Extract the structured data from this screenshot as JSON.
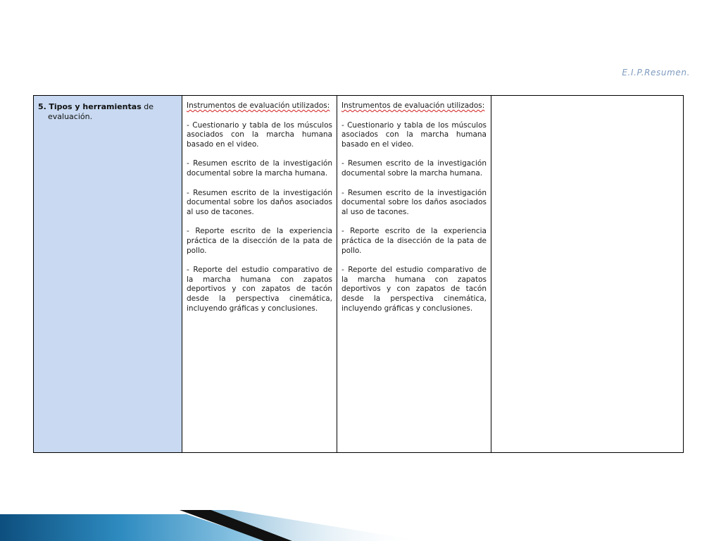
{
  "header": {
    "label": "E.I.P.Resumen."
  },
  "table": {
    "row_title": {
      "number": "5.",
      "bold": "Tipos y herramientas",
      "rest": "de",
      "line2": "evaluación."
    },
    "columns": [
      {
        "intro": "Instrumentos de evaluación utilizados:",
        "items": [
          "- Cuestionario y tabla de los músculos asociados con la marcha humana basado en el video.",
          "- Resumen escrito de la investigación documental sobre la marcha humana.",
          "- Resumen escrito de la investigación documental sobre los daños asociados al uso de tacones.",
          "- Reporte escrito de la experiencia práctica de la disección de la pata de pollo.",
          "- Reporte del estudio comparativo de la marcha humana con zapatos deportivos y con zapatos de tacón desde la perspectiva cinemática, incluyendo gráficas y conclusiones."
        ]
      },
      {
        "intro": "Instrumentos de evaluación utilizados:",
        "items": [
          "- Cuestionario y tabla de los músculos asociados con la marcha humana basado en el video.",
          "- Resumen escrito de la investigación documental sobre la marcha humana.",
          "- Resumen escrito de la investigación documental sobre los daños asociados al uso de tacones.",
          "- Reporte escrito de la experiencia práctica de la disección de la pata de pollo.",
          "- Reporte del estudio comparativo de la marcha humana con zapatos deportivos y con zapatos de tacón desde la perspectiva cinemática, incluyendo gráficas y conclusiones."
        ]
      }
    ]
  },
  "colors": {
    "header_text": "#7f9bbf",
    "title_cell_bg": "#c8d9f1",
    "footer_dark": "#1a1a1a",
    "footer_blue": "#1f6e9e"
  }
}
